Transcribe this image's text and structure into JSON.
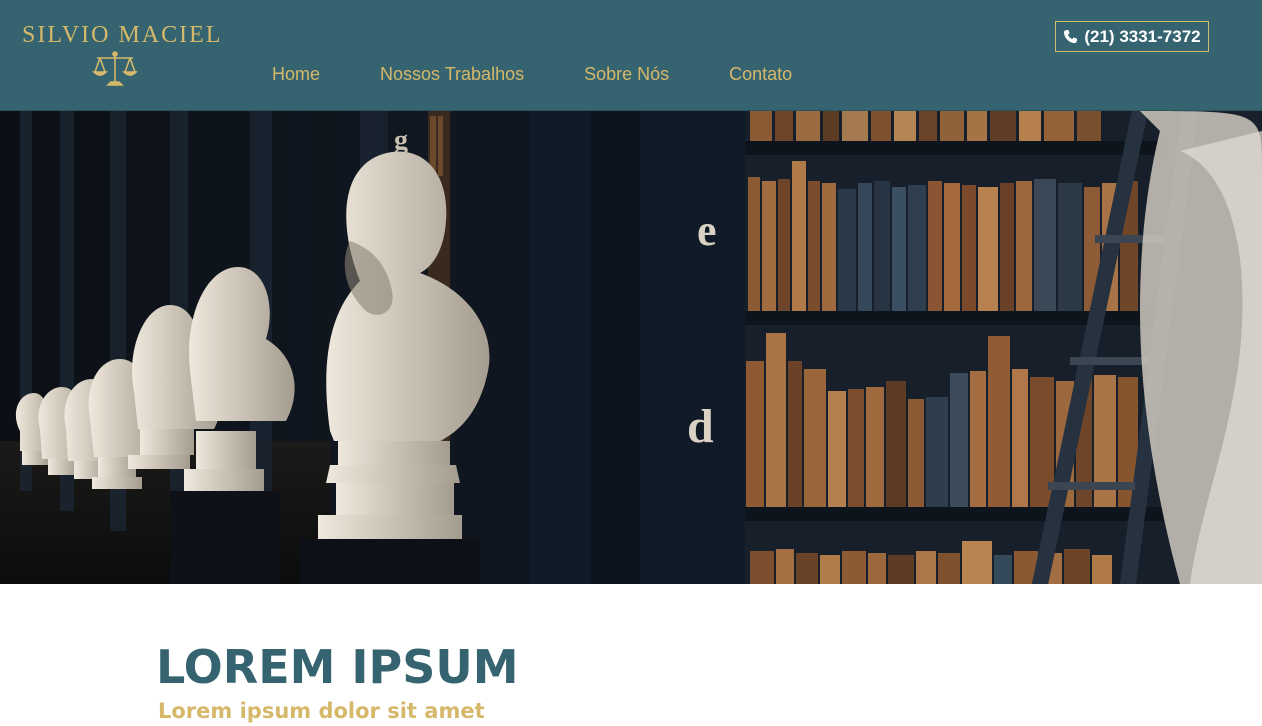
{
  "header": {
    "logo_text": "SILVIO MACIEL",
    "logo_icon": "scales-of-justice-icon",
    "nav": [
      {
        "label": "Home"
      },
      {
        "label": "Nossos Trabalhos"
      },
      {
        "label": "Sobre Nós"
      },
      {
        "label": "Contato"
      }
    ],
    "phone": "(21) 3331-7372",
    "phone_icon": "phone-icon"
  },
  "hero": {
    "shelf_letters": [
      "g",
      "e",
      "d"
    ]
  },
  "content": {
    "title": "LOREM IPSUM",
    "subtitle": "Lorem ipsum dolor sit amet"
  },
  "colors": {
    "header_bg": "#35636f",
    "accent_gold": "#d6b86a",
    "title_teal": "#35636f"
  }
}
